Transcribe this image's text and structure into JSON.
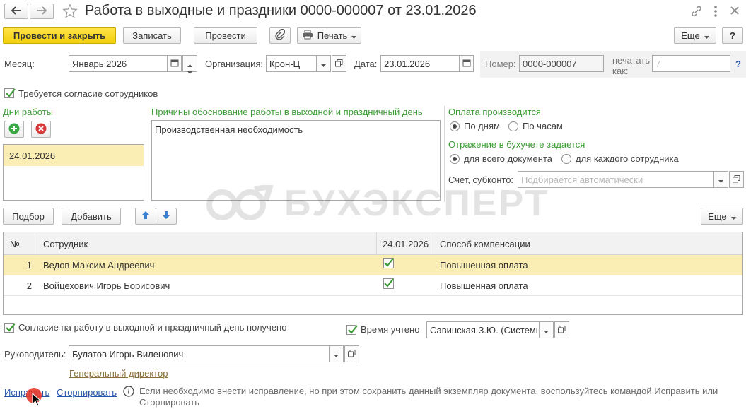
{
  "title": "Работа в выходные и праздники 0000-000007 от 23.01.2026",
  "toolbar": {
    "post_close": "Провести и закрыть",
    "save": "Записать",
    "post": "Провести",
    "print": "Печать",
    "more": "Еще"
  },
  "header": {
    "month_label": "Месяц:",
    "month_value": "Январь 2026",
    "org_label": "Организация:",
    "org_value": "Крон-Ц",
    "date_label": "Дата:",
    "date_value": "23.01.2026",
    "number_label": "Номер:",
    "number_value": "0000-000007",
    "print_as_label_1": "печатать",
    "print_as_label_2": "как:",
    "print_as_value": "7",
    "help": "?"
  },
  "consent_required": {
    "label": "Требуется согласие сотрудников",
    "checked": true
  },
  "workdays": {
    "title": "Дни работы",
    "items": [
      "24.01.2026"
    ]
  },
  "reasons": {
    "title": "Причины обоснование работы в выходной и праздничный день",
    "text": "Производственная необходимость"
  },
  "payment": {
    "title": "Оплата производится",
    "options": [
      "По дням",
      "По часам"
    ],
    "selected": "По дням"
  },
  "accounting": {
    "title": "Отражение в бухучете задается",
    "options": [
      "для всего документа",
      "для каждого сотрудника"
    ],
    "selected": "для всего документа",
    "account_label": "Счет, субконто:",
    "account_placeholder": "Подбирается автоматически"
  },
  "watermark": "БУХЭКСПЕРТ",
  "table_toolbar": {
    "pick": "Подбор",
    "add": "Добавить",
    "more": "Еще"
  },
  "table": {
    "headers": [
      "№",
      "Сотрудник",
      "24.01.2026",
      "Способ компенсации"
    ],
    "rows": [
      {
        "n": "1",
        "employee": "Ведов Максим Андреевич",
        "checked": true,
        "compensation": "Повышенная оплата"
      },
      {
        "n": "2",
        "employee": "Войцехович Игорь Борисович",
        "checked": true,
        "compensation": "Повышенная оплата"
      }
    ]
  },
  "footer": {
    "consent_received": "Согласие на работу в выходной и праздничный день получено",
    "time_counted": "Время учтено",
    "time_counted_by": "Савинская З.Ю. (Системн",
    "manager_label": "Руководитель:",
    "manager_value": "Булатов Игорь Виленович",
    "manager_position": "Генеральный директор",
    "fix_link": "Исправить",
    "storno_link": "Сторнировать",
    "info_text": "Если необходимо внести исправление, но при этом сохранить данный экземпляр документа, воспользуйтесь командой Исправить или Сторнировать"
  },
  "colors": {
    "accent_yellow": "#f4cf0c",
    "selected_row": "#fbeeb5",
    "section_green": "#3c9c35",
    "link_blue": "#2a55a6",
    "delete_red": "#d63a3a",
    "add_green": "#3aa844",
    "cursor_marker": "#e8392b"
  }
}
